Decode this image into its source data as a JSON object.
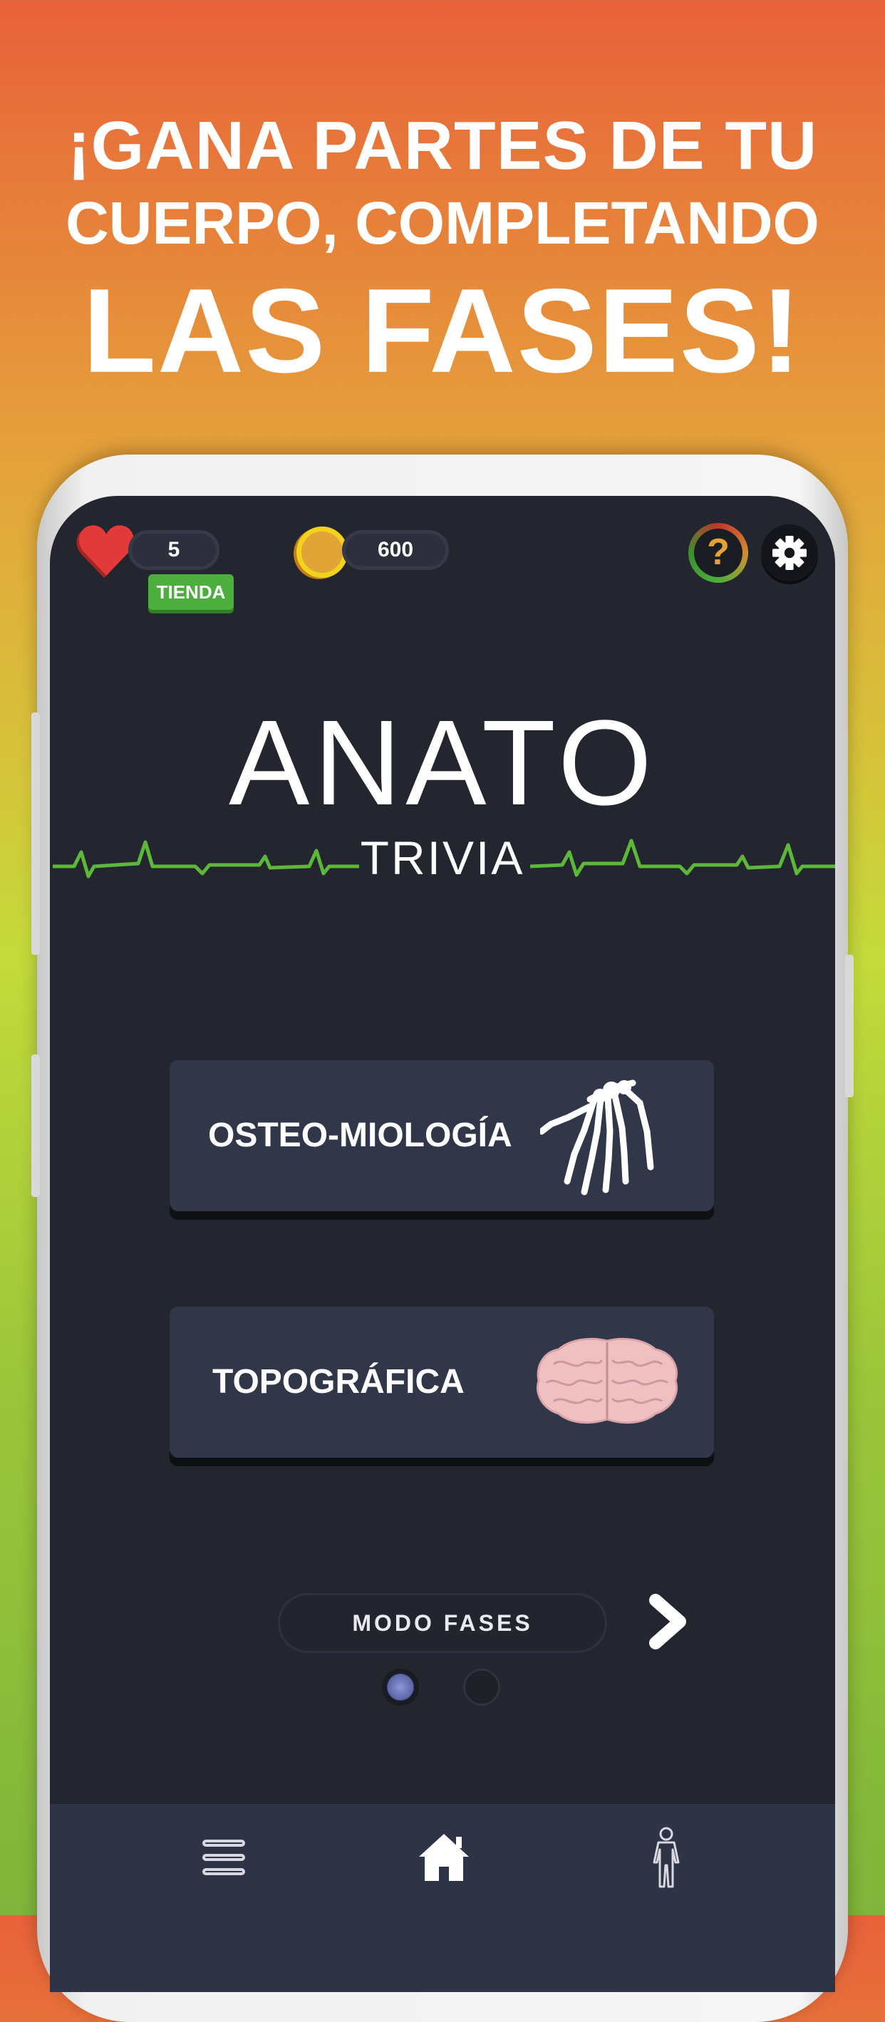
{
  "promo": {
    "line1": "¡GANA PARTES DE TU",
    "line2": "CUERPO, COMPLETANDO",
    "line3": "LAS FASES!"
  },
  "topbar": {
    "lives": "5",
    "store_label": "TIENDA",
    "coins": "600",
    "help_symbol": "?"
  },
  "logo": {
    "title": "ANATO",
    "subtitle": "TRIVIA"
  },
  "categories": [
    {
      "label": "OSTEO-MIOLOGÍA",
      "icon": "skeleton-hand-icon"
    },
    {
      "label": "TOPOGRÁFICA",
      "icon": "brain-icon"
    }
  ],
  "mode": {
    "label": "MODO FASES"
  },
  "pager": {
    "total": 2,
    "active": 1
  },
  "bottom_nav": [
    {
      "icon": "menu-icon"
    },
    {
      "icon": "home-icon"
    },
    {
      "icon": "body-icon"
    }
  ],
  "colors": {
    "screen_bg": "#23252f",
    "card_bg": "#323649",
    "accent_green": "#4caf3d",
    "heart_red": "#e23a3a",
    "coin_gold": "#e1a437",
    "pulse_green": "#5db83a"
  }
}
